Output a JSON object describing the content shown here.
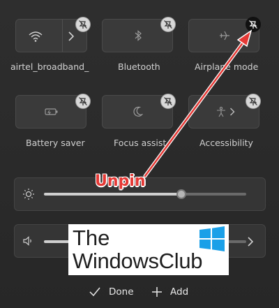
{
  "tiles": [
    {
      "name": "wifi",
      "label": "airtel_broadband_"
    },
    {
      "name": "bluetooth",
      "label": "Bluetooth"
    },
    {
      "name": "airplane-mode",
      "label": "Airplane mode"
    },
    {
      "name": "battery-saver",
      "label": "Battery saver"
    },
    {
      "name": "focus-assist",
      "label": "Focus assist"
    },
    {
      "name": "accessibility",
      "label": "Accessibility"
    }
  ],
  "annotation": {
    "label": "Unpin",
    "color": "#e53935"
  },
  "brightness": {
    "level_percent": 68
  },
  "volume": {
    "level_percent": 30
  },
  "watermark": {
    "line1": "The",
    "line2": "WindowsClub"
  },
  "footer": {
    "done_label": "Done",
    "add_label": "Add"
  },
  "colors": {
    "accent": "#e53935",
    "tile": "#3a3a3a",
    "background": "#2b2b2b"
  }
}
